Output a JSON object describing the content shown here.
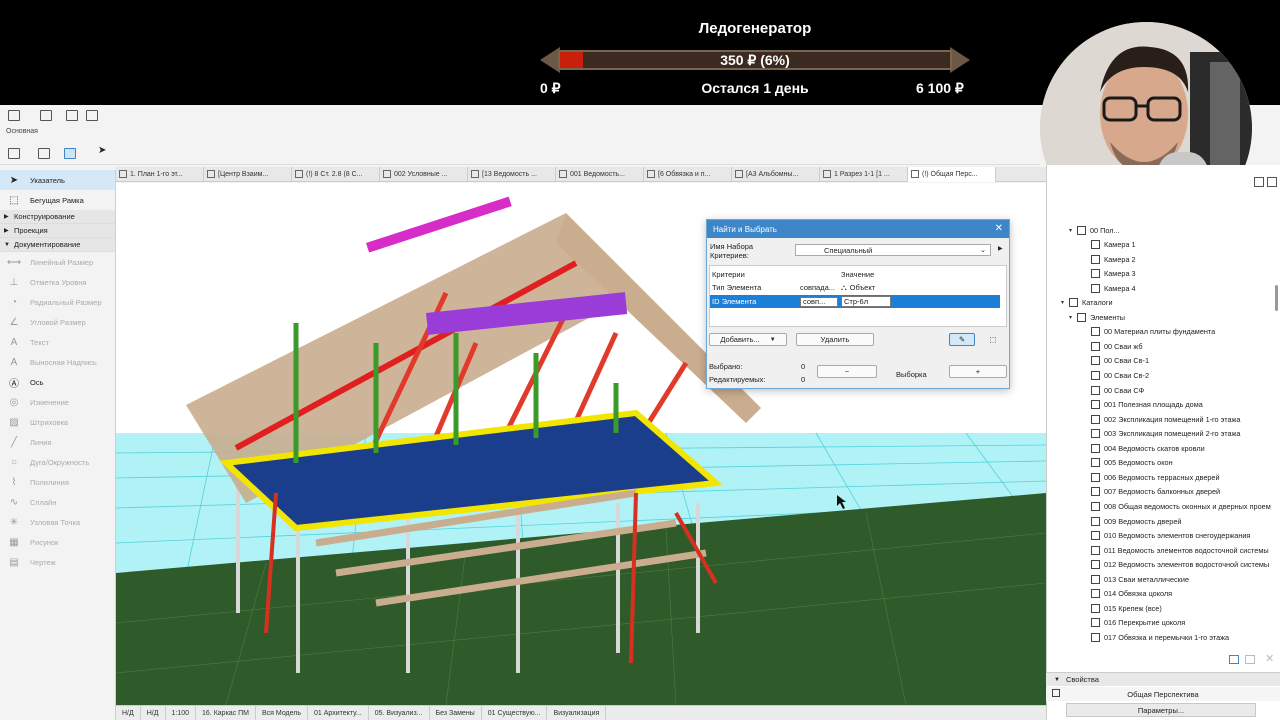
{
  "overlay": {
    "title": "Ледогенератор",
    "progress_text": "350 ₽ (6%)",
    "progress_fraction": 0.06,
    "min_label": "0 ₽",
    "remaining_label": "Остался 1 день",
    "max_label": "6 100 ₽",
    "bar_color": "#c8200a"
  },
  "toolbar": {
    "section_label": "Основная"
  },
  "palette": {
    "pointer": "Указатель",
    "marquee": "Бегущая Рамка",
    "sections": [
      "Конструирование",
      "Проекция",
      "Документирование"
    ],
    "tools": [
      {
        "label": "Линейный Размер",
        "icon": "linear-dimension-icon",
        "glyph": "⟷",
        "enabled": false
      },
      {
        "label": "Отметка Уровня",
        "icon": "level-mark-icon",
        "glyph": "⊥",
        "enabled": false
      },
      {
        "label": "Радиальный Размер",
        "icon": "radial-dimension-icon",
        "glyph": "◔",
        "enabled": false
      },
      {
        "label": "Угловой Размер",
        "icon": "angle-dimension-icon",
        "glyph": "∠",
        "enabled": false
      },
      {
        "label": "Текст",
        "icon": "text-icon",
        "glyph": "A",
        "enabled": false
      },
      {
        "label": "Выносная Надпись",
        "icon": "label-icon",
        "glyph": "A",
        "enabled": false
      },
      {
        "label": "Ось",
        "icon": "axis-icon",
        "glyph": "Ⓐ",
        "enabled": true
      },
      {
        "label": "Изменение",
        "icon": "change-icon",
        "glyph": "◎",
        "enabled": false
      },
      {
        "label": "Штриховка",
        "icon": "hatch-icon",
        "glyph": "▨",
        "enabled": false
      },
      {
        "label": "Линия",
        "icon": "line-icon",
        "glyph": "╱",
        "enabled": false
      },
      {
        "label": "Дуга/Окружность",
        "icon": "arc-icon",
        "glyph": "○",
        "enabled": false
      },
      {
        "label": "Полилиния",
        "icon": "polyline-icon",
        "glyph": "⌇",
        "enabled": false
      },
      {
        "label": "Сплайн",
        "icon": "spline-icon",
        "glyph": "∿",
        "enabled": false
      },
      {
        "label": "Узловая Точка",
        "icon": "hotspot-icon",
        "glyph": "✳",
        "enabled": false
      },
      {
        "label": "Рисунок",
        "icon": "figure-icon",
        "glyph": "▦",
        "enabled": false
      },
      {
        "label": "Чертеж",
        "icon": "drawing-icon",
        "glyph": "▤",
        "enabled": false
      }
    ]
  },
  "tabs": [
    {
      "label": "1. План 1-го эт...",
      "active": false
    },
    {
      "label": "[Центр Взаим...",
      "active": false
    },
    {
      "label": "(!) 8 Ст. 2.8 (8 С...",
      "active": false
    },
    {
      "label": "002 Условные ...",
      "active": false
    },
    {
      "label": "[13 Ведомость ...",
      "active": false
    },
    {
      "label": "001 Ведомость...",
      "active": false
    },
    {
      "label": "[6 Обвязка и п...",
      "active": false
    },
    {
      "label": "[А3 Альбомны...",
      "active": false
    },
    {
      "label": "1 Разрез 1-1 [1 ...",
      "active": false
    },
    {
      "label": "(!) Общая Перс...",
      "active": true
    }
  ],
  "dialog": {
    "title": "Найти и Выбрать",
    "set_label_1": "Имя Набора",
    "set_label_2": "Критериев:",
    "set_value": "Специальный",
    "col_criteria": "Критерии",
    "col_value": "Значение",
    "rows": [
      {
        "criterion": "Тип Элемента",
        "op": "совпада...",
        "value": "Объект"
      },
      {
        "criterion": "ID Элемента",
        "op": "совп...",
        "value": "Стр-6л"
      }
    ],
    "add_button": "Добавить...",
    "remove_button": "Удалить",
    "selected_label": "Выбрано:",
    "selected_value": "0",
    "editable_label": "Редактируемых:",
    "editable_value": "0",
    "minus": "−",
    "selection_label": "Выборка",
    "plus": "+"
  },
  "navigator": {
    "items": [
      {
        "label": "00 Пол...",
        "level": 1,
        "expander": "▾",
        "icon": "camera-path-icon"
      },
      {
        "label": "Камера 1",
        "level": 2,
        "expander": "",
        "icon": "camera-icon"
      },
      {
        "label": "Камера 2",
        "level": 2,
        "expander": "",
        "icon": "camera-icon"
      },
      {
        "label": "Камера 3",
        "level": 2,
        "expander": "",
        "icon": "camera-icon"
      },
      {
        "label": "Камера 4",
        "level": 2,
        "expander": "",
        "icon": "camera-icon"
      },
      {
        "label": "Каталоги",
        "level": 0,
        "expander": "▾",
        "icon": "schedule-folder-icon"
      },
      {
        "label": "Элементы",
        "level": 1,
        "expander": "▾",
        "icon": "elements-folder-icon"
      },
      {
        "label": "00 Материал плиты фундамента",
        "level": 2,
        "expander": "",
        "icon": "schedule-icon"
      },
      {
        "label": "00 Сваи жб",
        "level": 2,
        "expander": "",
        "icon": "schedule-icon"
      },
      {
        "label": "00 Сваи Св-1",
        "level": 2,
        "expander": "",
        "icon": "schedule-icon"
      },
      {
        "label": "00 Сваи Св-2",
        "level": 2,
        "expander": "",
        "icon": "schedule-icon"
      },
      {
        "label": "00 Сваи СФ",
        "level": 2,
        "expander": "",
        "icon": "schedule-icon"
      },
      {
        "label": "001 Полезная площадь дома",
        "level": 2,
        "expander": "",
        "icon": "schedule-icon"
      },
      {
        "label": "002 Экспликация помещений 1-го этажа",
        "level": 2,
        "expander": "",
        "icon": "schedule-icon"
      },
      {
        "label": "003 Экспликация помещений 2-го этажа",
        "level": 2,
        "expander": "",
        "icon": "schedule-icon"
      },
      {
        "label": "004 Ведомость скатов кровли",
        "level": 2,
        "expander": "",
        "icon": "schedule-icon"
      },
      {
        "label": "005 Ведомость окон",
        "level": 2,
        "expander": "",
        "icon": "schedule-icon"
      },
      {
        "label": "006 Ведомость террасных дверей",
        "level": 2,
        "expander": "",
        "icon": "schedule-icon"
      },
      {
        "label": "007 Ведомость балконных дверей",
        "level": 2,
        "expander": "",
        "icon": "schedule-icon"
      },
      {
        "label": "008 Общая ведомость оконных и дверных проем",
        "level": 2,
        "expander": "",
        "icon": "schedule-icon"
      },
      {
        "label": "009 Ведомость дверей",
        "level": 2,
        "expander": "",
        "icon": "schedule-icon"
      },
      {
        "label": "010 Ведомость элементов снегоудержания",
        "level": 2,
        "expander": "",
        "icon": "schedule-icon"
      },
      {
        "label": "011 Ведомость элементов водосточной системы",
        "level": 2,
        "expander": "",
        "icon": "schedule-icon"
      },
      {
        "label": "012 Ведомость элементов водосточной системы",
        "level": 2,
        "expander": "",
        "icon": "schedule-icon"
      },
      {
        "label": "013 Сваи металлические",
        "level": 2,
        "expander": "",
        "icon": "schedule-icon"
      },
      {
        "label": "014 Обвязка цоколя",
        "level": 2,
        "expander": "",
        "icon": "schedule-icon"
      },
      {
        "label": "015 Крепеж (все)",
        "level": 2,
        "expander": "",
        "icon": "schedule-icon"
      },
      {
        "label": "016 Перекрытие цоколя",
        "level": 2,
        "expander": "",
        "icon": "schedule-icon"
      },
      {
        "label": "017 Обвязка и перемычки 1-го этажа",
        "level": 2,
        "expander": "",
        "icon": "schedule-icon"
      }
    ],
    "properties_header": "Свойства",
    "properties_view": "Общая Перспектива",
    "parameters_button": "Параметры..."
  },
  "statusbar": {
    "cells": [
      "Н/Д",
      "Н/Д",
      "1:100",
      "16. Каркас ПМ",
      "Вся Модель",
      "01 Архитекту...",
      "05. Визуализ...",
      "Без Замены",
      "01 Существую...",
      "Визуализация"
    ]
  },
  "colors": {
    "accent": "#3d87c9",
    "selection": "#1e7fd6",
    "ground": "#2f5a2a",
    "grid": "#48e0e8"
  }
}
